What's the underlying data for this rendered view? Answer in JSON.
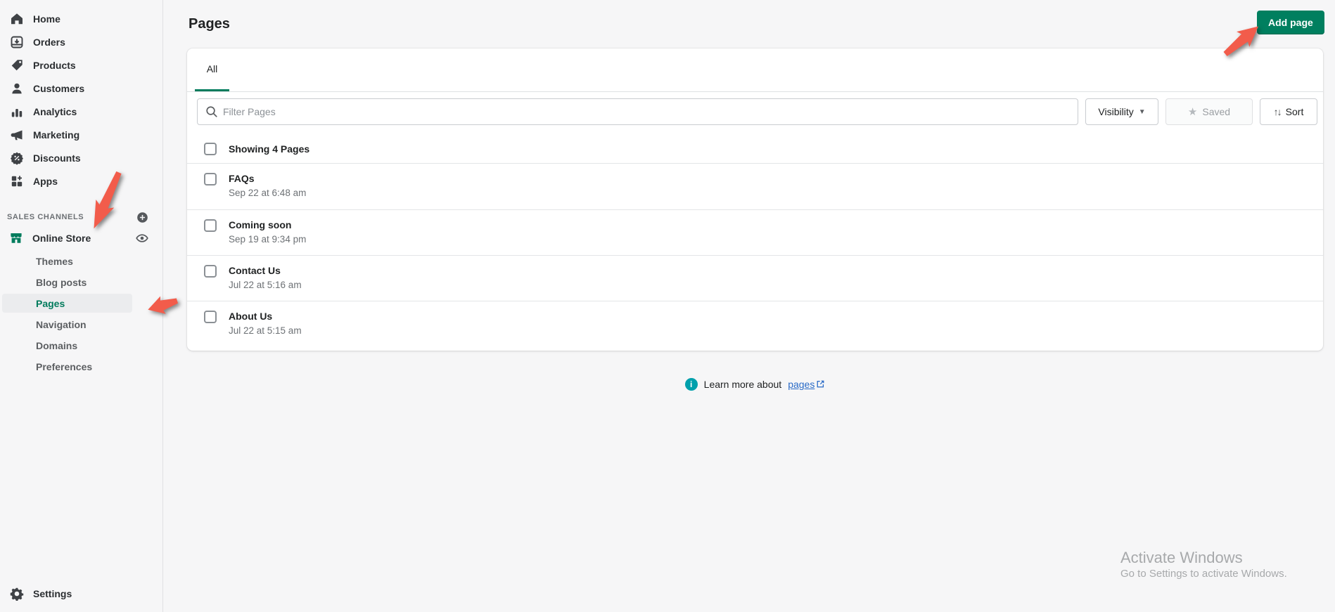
{
  "colors": {
    "accent_green": "#007f5f",
    "selected_item_green": "#007b5c",
    "link_blue": "#2a6bc7",
    "info_teal": "#00a0ac",
    "annotation_arrow_red": "#f25c4b"
  },
  "sidebar": {
    "items": [
      {
        "label": "Home"
      },
      {
        "label": "Orders"
      },
      {
        "label": "Products"
      },
      {
        "label": "Customers"
      },
      {
        "label": "Analytics"
      },
      {
        "label": "Marketing"
      },
      {
        "label": "Discounts"
      },
      {
        "label": "Apps"
      }
    ],
    "sales_channels": {
      "heading": "SALES CHANNELS",
      "online_store_label": "Online Store",
      "sub_items": [
        "Themes",
        "Blog posts",
        "Pages",
        "Navigation",
        "Domains",
        "Preferences"
      ],
      "selected_sub_item": "Pages"
    },
    "settings_label": "Settings"
  },
  "header": {
    "title": "Pages",
    "add_page_label": "Add page"
  },
  "card": {
    "tabs": [
      {
        "label": "All",
        "active": true
      }
    ],
    "filter": {
      "search_placeholder": "Filter Pages",
      "visibility_label": "Visibility",
      "saved_label": "Saved",
      "sort_label": "Sort"
    },
    "summary": "Showing 4 Pages",
    "rows": [
      {
        "title": "FAQs",
        "date": "Sep 22 at 6:48 am"
      },
      {
        "title": "Coming soon",
        "date": "Sep 19 at 9:34 pm"
      },
      {
        "title": "Contact Us",
        "date": "Jul 22 at 5:16 am"
      },
      {
        "title": "About Us",
        "date": "Jul 22 at 5:15 am"
      }
    ]
  },
  "footer": {
    "learn_more_prefix": "Learn more about",
    "link_label": "pages"
  },
  "watermark": {
    "line1": "Activate Windows",
    "line2": "Go to Settings to activate Windows."
  }
}
